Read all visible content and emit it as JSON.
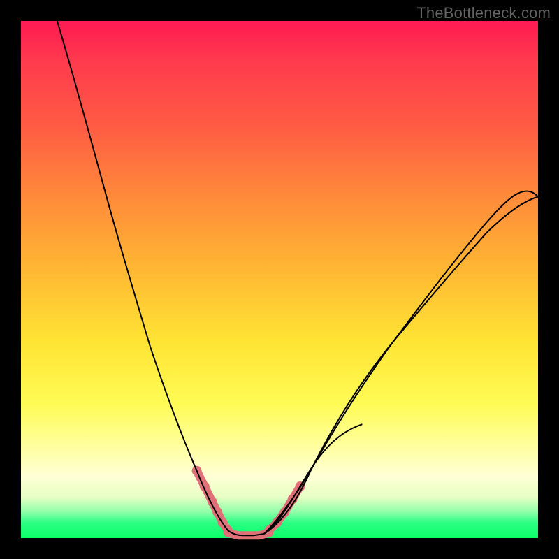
{
  "watermark": "TheBottleneck.com",
  "chart_data": {
    "type": "line",
    "title": "",
    "xlabel": "",
    "ylabel": "",
    "xlim": [
      0,
      100
    ],
    "ylim": [
      0,
      100
    ],
    "grid": false,
    "legend": false,
    "background": {
      "type": "vertical-gradient",
      "stops": [
        {
          "pos": 0.0,
          "color": "#ff1a52"
        },
        {
          "pos": 0.5,
          "color": "#ffcb33"
        },
        {
          "pos": 0.82,
          "color": "#ffff9c"
        },
        {
          "pos": 1.0,
          "color": "#0cff6a"
        }
      ]
    },
    "series": [
      {
        "name": "bottleneck-curve-left",
        "color": "#000000",
        "x": [
          7,
          10,
          13,
          16,
          19,
          22,
          25,
          28,
          31,
          34,
          36,
          38,
          40,
          42
        ],
        "y": [
          100,
          90,
          79,
          68,
          57,
          47,
          37,
          28,
          20,
          13,
          8,
          5,
          3,
          1
        ]
      },
      {
        "name": "bottleneck-curve-right",
        "color": "#000000",
        "x": [
          48,
          52,
          56,
          60,
          66,
          72,
          78,
          84,
          90,
          96,
          100
        ],
        "y": [
          1,
          4,
          9,
          14,
          22,
          30,
          38,
          46,
          54,
          61,
          66
        ]
      },
      {
        "name": "optimal-flat",
        "color": "#e07078",
        "x": [
          40,
          42,
          44,
          46,
          48
        ],
        "y": [
          1,
          0.5,
          0.5,
          0.5,
          1
        ]
      }
    ],
    "markers": [
      {
        "name": "left-dots",
        "color": "#e07078",
        "x": [
          34,
          35.5,
          37,
          38,
          39,
          40
        ],
        "y": [
          13,
          10,
          7,
          5,
          3,
          1.5
        ]
      },
      {
        "name": "right-dots",
        "color": "#e07078",
        "x": [
          48,
          49.5,
          51,
          52.5,
          54
        ],
        "y": [
          1.5,
          3,
          5,
          7.5,
          10
        ]
      }
    ]
  }
}
